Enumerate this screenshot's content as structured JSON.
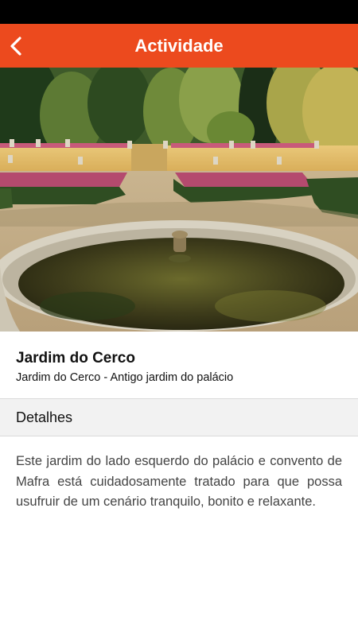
{
  "status_bar": {},
  "header": {
    "title": "Actividade",
    "back_icon": "chevron-left-icon",
    "background_color": "#ec4a1e"
  },
  "hero_image": {
    "subject": "garden-fountain-photo"
  },
  "activity": {
    "title": "Jardim do Cerco",
    "subtitle": "Jardim do Cerco - Antigo jardim do palácio"
  },
  "details_section": {
    "title": "Detalhes",
    "description": "Este jardim do lado esquerdo do palácio e convento de Mafra está cuidadosamente tratado para que possa usufruir de um cenário tranquilo, bonito e relaxante."
  }
}
